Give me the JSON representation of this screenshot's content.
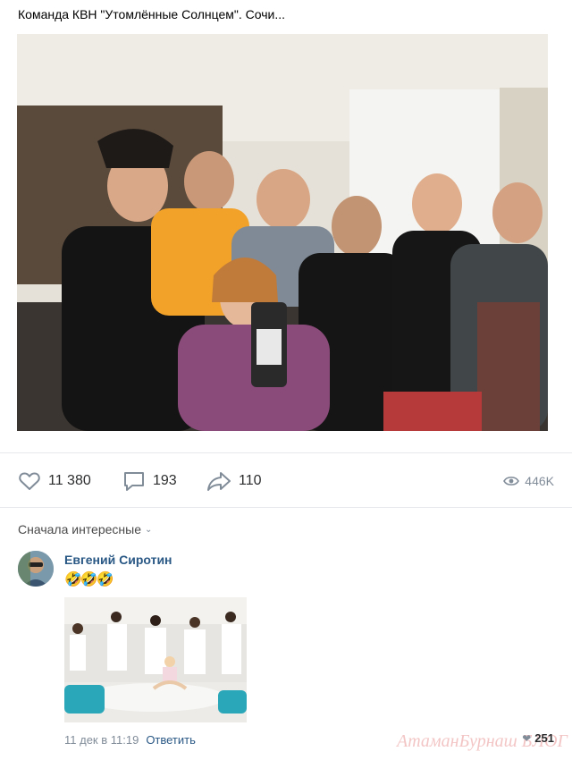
{
  "post": {
    "title": "Команда КВН \"Утомлённые Солнцем\". Сочи...",
    "stats": {
      "likes": "11 380",
      "comments": "193",
      "shares": "110",
      "views": "446K"
    },
    "icons": [
      "heart-icon",
      "comment-icon",
      "share-arrow-icon",
      "eye-icon"
    ]
  },
  "comments_section": {
    "sort_label": "Сначала интересные",
    "comment": {
      "author": "Евгений Сиротин",
      "emojis": "🤣🤣🤣",
      "date": "11 дек в 11:19",
      "reply_label": "Ответить",
      "likes": "251"
    }
  },
  "watermark": "АтаманБурнаш БЛОГ"
}
